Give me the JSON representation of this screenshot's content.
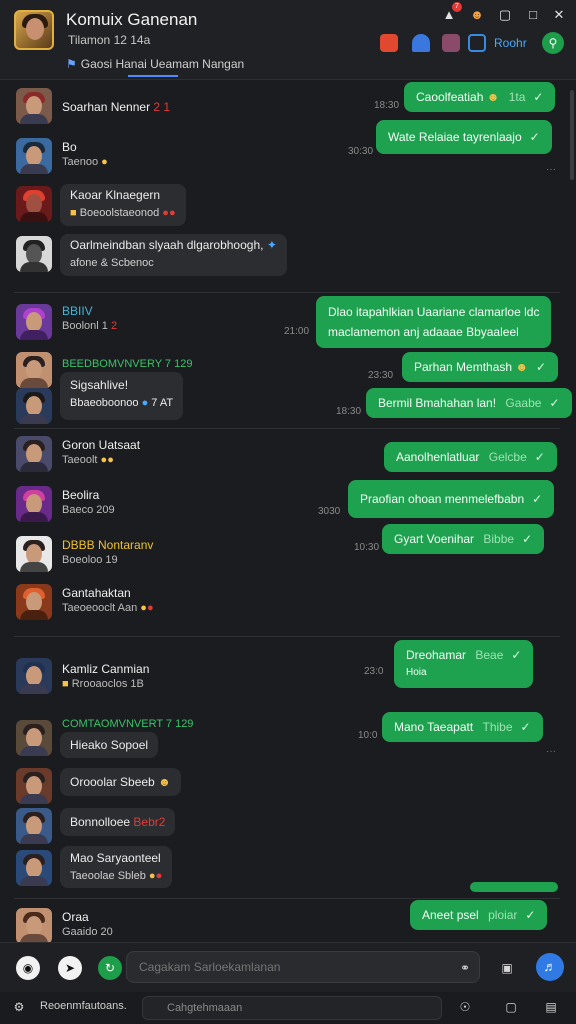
{
  "header": {
    "title": "Komuix Ganenan",
    "subtitle": "Tilamon 12 14a",
    "members_label": "Gaosi  Hanai  Ueamam Nangan",
    "toolbar_label": "Roohr"
  },
  "colors": {
    "background": "#1b1c1f",
    "header_bg": "#202124",
    "outgoing_bubble": "#1fa24f",
    "incoming_bubble": "#2c2d31",
    "accent_blue": "#2f7ae5",
    "badge_red": "#e53935"
  },
  "rows": [
    {
      "name": "Soarhan Nenner",
      "badge": "2 1"
    },
    {
      "name": "Bo",
      "sub": "Taenoo"
    },
    {
      "name": "Kaoar Klnaegern",
      "sub": "Boeoolstaeonod"
    },
    {
      "name": "Oarlmeindban slyaah dlgarobhoogh,",
      "sub": "afone & Scbenoc"
    },
    {
      "name": "BBIIV",
      "sub": "Boolonl 1"
    },
    {
      "name": "BEEDBOMVNVERY 7 129",
      "sub": "Sigsahlive!"
    },
    {
      "name": "Bbaeoboonoo",
      "badge": "7 AT"
    },
    {
      "name": "Goron Uatsaat",
      "sub": "Taeoolt"
    },
    {
      "name": "Beolira",
      "sub": "Baeco 209"
    },
    {
      "name": "DBBB Nontaranv",
      "sub": "Boeoloo 19"
    },
    {
      "name": "Gantahaktan",
      "sub": "Taeoeooclt Aan"
    },
    {
      "name": "Kamliz Canmian",
      "sub": "Rrooaoclos 1B"
    },
    {
      "name": "COMTAOMVNVERT 7 129",
      "sub": "Hieako Sopoel"
    },
    {
      "name": "Orooolar Sbeeb"
    },
    {
      "name": "Bonnolloee",
      "badge": "Bebr2"
    },
    {
      "name": "Mao Saryaonteel",
      "sub": "Taeoolae Sbleb"
    },
    {
      "name": "Oraa",
      "sub": "Gaaido 20"
    }
  ],
  "outgoing": [
    {
      "text": "Caoolfeatiah",
      "extra": "1ta"
    },
    {
      "text": "Wate Relaiae tayrenlaajo"
    },
    {
      "text": "Dlao itapahlkian Uaariane clamarloe ldc",
      "text2": "maclamemon anj adaaae Bbyaaleel"
    },
    {
      "text": "Parhan Memthash"
    },
    {
      "text": "Bermil Bmahahan lan!",
      "extra": "Gaabe"
    },
    {
      "text": "Aanolhenlatluar",
      "extra": "Gelcbe"
    },
    {
      "text": "Praofian ohoan menmelefbabn"
    },
    {
      "text": "Gyart Voenihar",
      "extra": "Bibbe"
    },
    {
      "text": "Dreohamar",
      "extra": "Beae",
      "text2": "Hoia"
    },
    {
      "text": "Mano Taeapatt",
      "extra": "Thibe"
    },
    {
      "text": "Aneet psel",
      "extra": "ploiar"
    }
  ],
  "times": [
    "18:30",
    "30:30",
    "21:00",
    "23:30",
    "18:30",
    "3030",
    "10:30",
    "23:0",
    "10:0"
  ],
  "composer": {
    "placeholder": "Cagakam Sarloekamlanan"
  },
  "statusbar": {
    "label": "Reoenmfautoans.",
    "search_placeholder": "Cahgtehmaaan"
  }
}
